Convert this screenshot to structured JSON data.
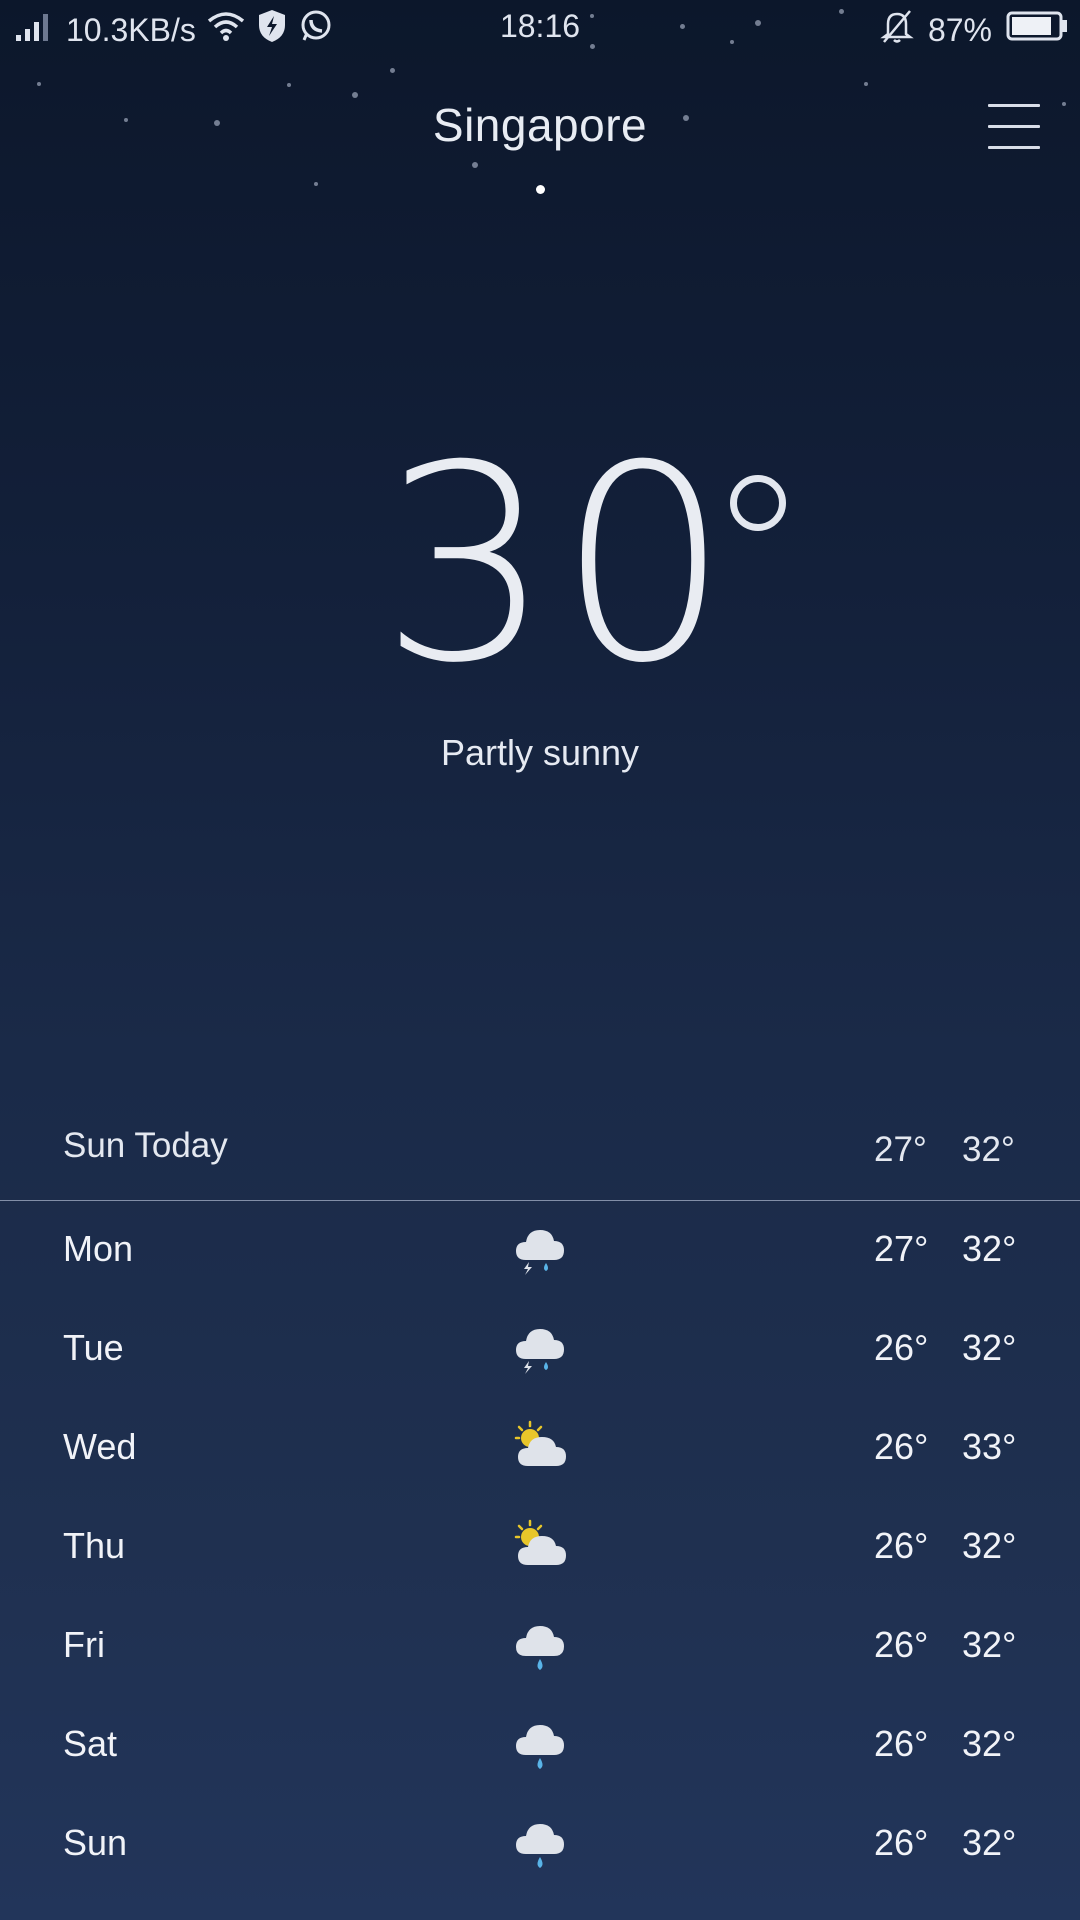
{
  "statusbar": {
    "network_speed": "10.3KB/s",
    "time": "18:16",
    "battery_percent": "87%",
    "battery_level": 0.87,
    "icons": [
      "signal-icon",
      "wifi-icon",
      "shield-icon",
      "whatsapp-icon",
      "bell-off-icon",
      "battery-icon"
    ]
  },
  "header": {
    "city": "Singapore",
    "menu_icon": "menu-icon"
  },
  "current": {
    "temperature": "30",
    "condition": "Partly sunny"
  },
  "today": {
    "label": "Sun  Today",
    "low": "27°",
    "high": "32°"
  },
  "forecast": [
    {
      "day": "Mon",
      "icon": "thunderstorm-icon",
      "low": "27°",
      "high": "32°"
    },
    {
      "day": "Tue",
      "icon": "thunderstorm-icon",
      "low": "26°",
      "high": "32°"
    },
    {
      "day": "Wed",
      "icon": "partly-sunny-icon",
      "low": "26°",
      "high": "33°"
    },
    {
      "day": "Thu",
      "icon": "partly-sunny-icon",
      "low": "26°",
      "high": "32°"
    },
    {
      "day": "Fri",
      "icon": "rain-icon",
      "low": "26°",
      "high": "32°"
    },
    {
      "day": "Sat",
      "icon": "rain-icon",
      "low": "26°",
      "high": "32°"
    },
    {
      "day": "Sun",
      "icon": "rain-icon",
      "low": "26°",
      "high": "32°"
    }
  ],
  "colors": {
    "background_top": "#0c172b",
    "background_bottom": "#22355a",
    "sun": "#e8c62a",
    "rain": "#59b4e8",
    "cloud": "#dfe3ea"
  }
}
